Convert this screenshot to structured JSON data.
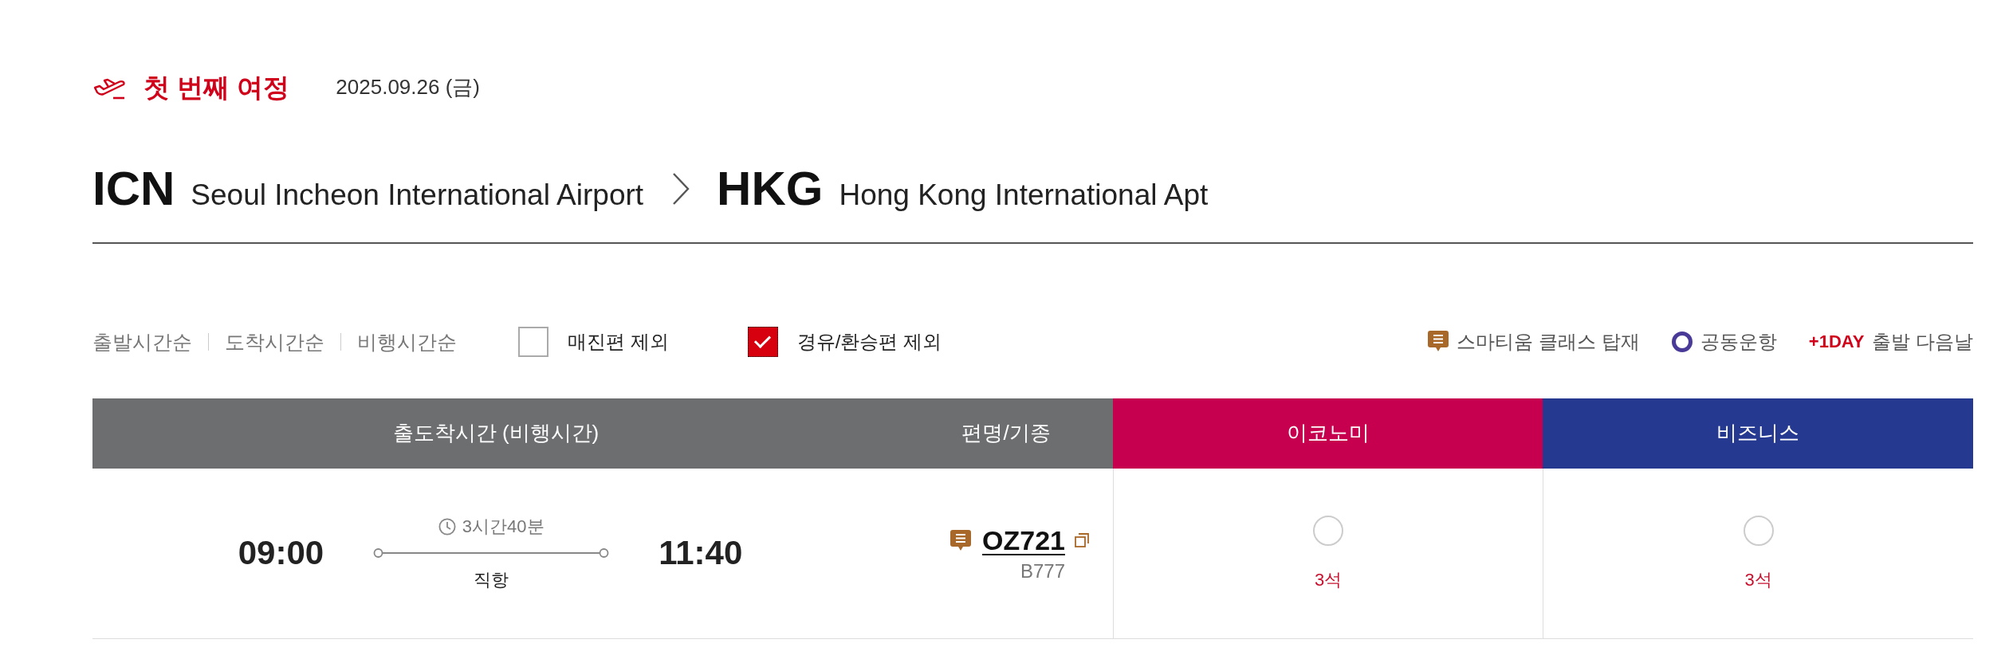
{
  "journey": {
    "title": "첫 번째 여정",
    "date": "2025.09.26 (금)"
  },
  "route": {
    "origin": {
      "code": "ICN",
      "name": "Seoul Incheon International Airport"
    },
    "destination": {
      "code": "HKG",
      "name": "Hong Kong International Apt"
    }
  },
  "sort_options": [
    "출발시간순",
    "도착시간순",
    "비행시간순"
  ],
  "filters": [
    {
      "label": "매진편 제외",
      "checked": false
    },
    {
      "label": "경유/환승편 제외",
      "checked": true
    }
  ],
  "legend": [
    {
      "kind": "smartium",
      "label": "스마티움 클래스 탑재"
    },
    {
      "kind": "codeshare",
      "label": "공동운항"
    },
    {
      "kind": "next_day",
      "badge": "+1DAY",
      "label": "출발 다음날"
    }
  ],
  "table": {
    "columns": [
      {
        "label": "출도착시간 (비행시간)",
        "color": "#6d6e70"
      },
      {
        "label": "편명/기종",
        "color": "#6d6e70"
      },
      {
        "label": "이코노미",
        "color": "#c6004f"
      },
      {
        "label": "비즈니스",
        "color": "#263990"
      }
    ],
    "rows": [
      {
        "departure": "09:00",
        "duration": "3시간40분",
        "stops": "직항",
        "arrival": "11:40",
        "smartium": true,
        "flight_number": "OZ721",
        "aircraft": "B777",
        "fares": [
          {
            "selected": false,
            "seats": "3석"
          },
          {
            "selected": false,
            "seats": "3석"
          }
        ]
      }
    ]
  }
}
